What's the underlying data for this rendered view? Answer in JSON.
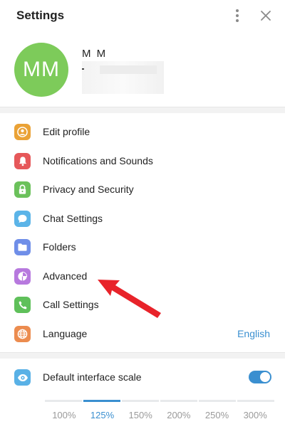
{
  "header": {
    "title": "Settings",
    "menu_icon": "more-vertical-icon",
    "close_icon": "close-icon"
  },
  "profile": {
    "avatar_initials": "MM",
    "avatar_color": "#7dcb5a",
    "name": "M M"
  },
  "menu": {
    "items": [
      {
        "label": "Edit profile",
        "icon": "user-circle-icon",
        "color": "#eaa236"
      },
      {
        "label": "Notifications and Sounds",
        "icon": "bell-icon",
        "color": "#e6585a"
      },
      {
        "label": "Privacy and Security",
        "icon": "lock-icon",
        "color": "#6bc15b"
      },
      {
        "label": "Chat Settings",
        "icon": "chat-bubble-icon",
        "color": "#5bb4e8"
      },
      {
        "label": "Folders",
        "icon": "folder-icon",
        "color": "#6f8ee8"
      },
      {
        "label": "Advanced",
        "icon": "pie-chart-icon",
        "color": "#b779de"
      },
      {
        "label": "Call Settings",
        "icon": "phone-icon",
        "color": "#5fc05a"
      },
      {
        "label": "Language",
        "icon": "globe-icon",
        "color": "#ec8c4f",
        "value": "English"
      }
    ]
  },
  "interface_scale": {
    "label": "Default interface scale",
    "icon": "eye-icon",
    "enabled": true,
    "options": [
      "100%",
      "125%",
      "150%",
      "200%",
      "250%",
      "300%"
    ],
    "selected": "125%"
  },
  "accent_color": "#3a8fd0",
  "annotation_arrow_color": "#e8232a"
}
